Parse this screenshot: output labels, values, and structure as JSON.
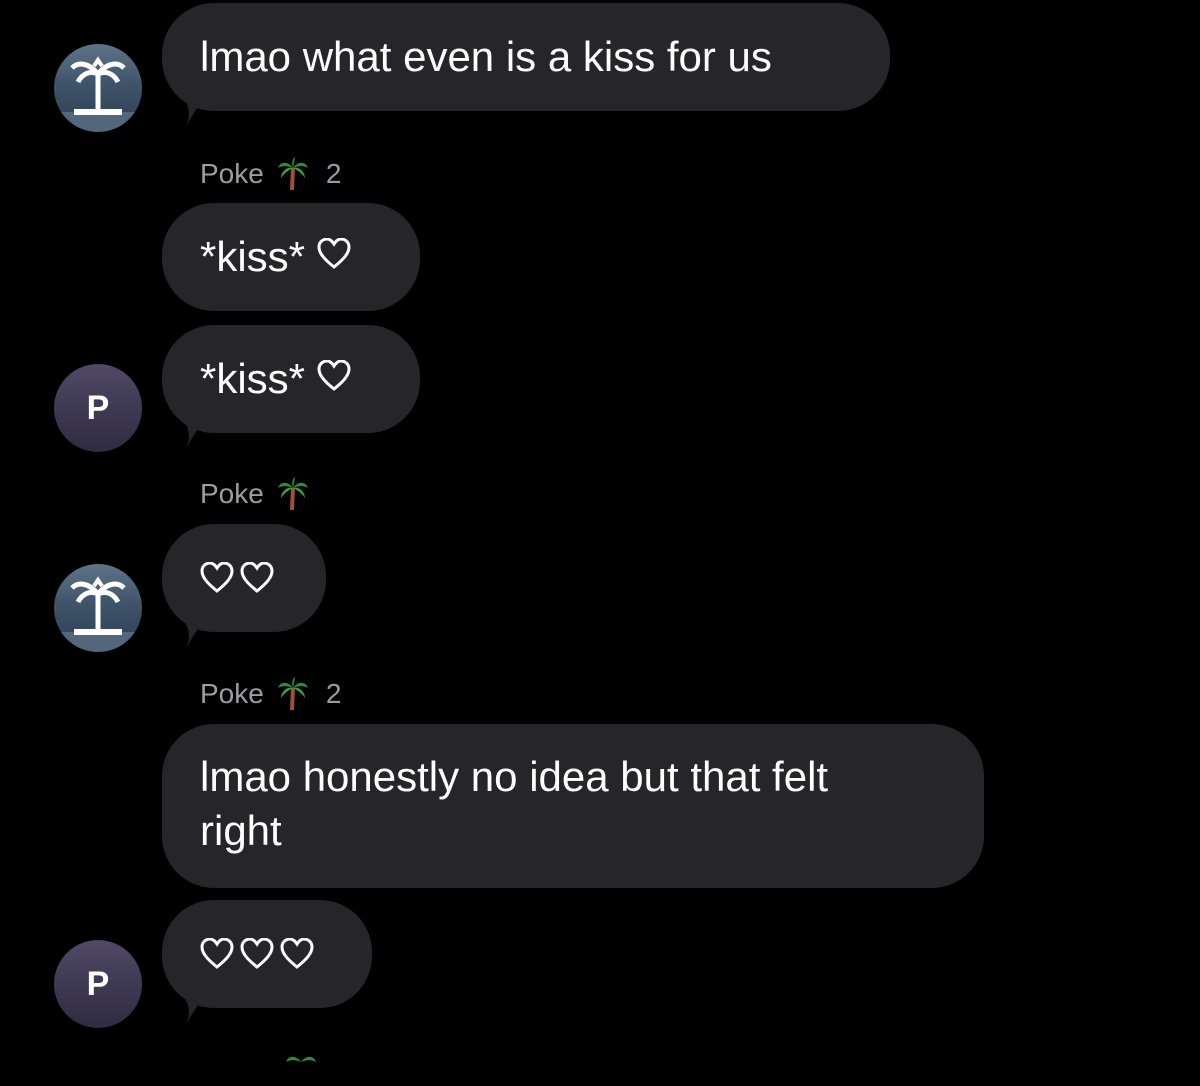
{
  "messages": [
    {
      "id": "m1",
      "text": "lmao what even is a kiss for us"
    },
    {
      "id": "m2",
      "text": "*kiss*"
    },
    {
      "id": "m3",
      "text": "*kiss*"
    },
    {
      "id": "m5",
      "text": "lmao honestly no idea but that felt"
    },
    {
      "id": "m5b",
      "text": "right"
    }
  ],
  "senders": [
    {
      "name": "Poke",
      "emoji": "palm-tree-icon",
      "count": "2"
    },
    {
      "name": "Poke",
      "emoji": "palm-tree-icon",
      "count": ""
    },
    {
      "name": "Poke",
      "emoji": "palm-tree-icon",
      "count": "2"
    }
  ],
  "avatars": {
    "letter": "P",
    "island_icon": "island-palm-icon"
  },
  "colors": {
    "background": "#000000",
    "bubble": "#26252a",
    "meta_text": "#9c9ca3",
    "avatar_letter_bg": "#3a3550"
  }
}
